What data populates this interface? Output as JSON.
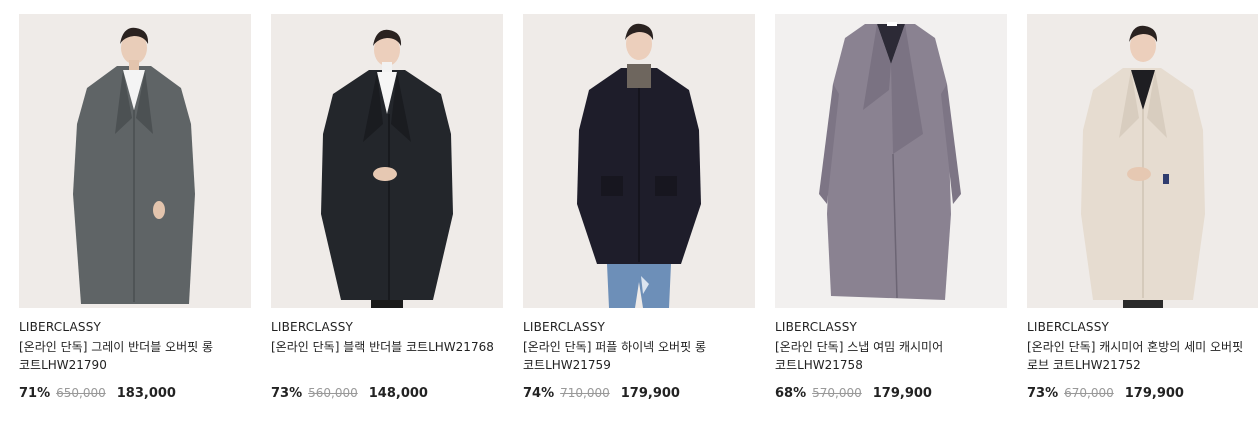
{
  "products": [
    {
      "brand": "LIBERCLASSY",
      "name": "[온라인 단독] 그레이 반더블 오버핏 롱 코트LHW21790",
      "discount": "71%",
      "original_price": "650,000",
      "sale_price": "183,000",
      "image_bg": "#efebe8",
      "coat_color": "#5f6466"
    },
    {
      "brand": "LIBERCLASSY",
      "name": "[온라인 단독] 블랙 반더블 코트LHW21768",
      "discount": "73%",
      "original_price": "560,000",
      "sale_price": "148,000",
      "image_bg": "#efebe8",
      "coat_color": "#23262b"
    },
    {
      "brand": "LIBERCLASSY",
      "name": "[온라인 단독] 퍼플 하이넥 오버핏 롱 코트LHW21759",
      "discount": "74%",
      "original_price": "710,000",
      "sale_price": "179,900",
      "image_bg": "#efebe8",
      "coat_color": "#1e1d2a"
    },
    {
      "brand": "LIBERCLASSY",
      "name": "[온라인 단독] 스냅 여밈 캐시미어 코트LHW21758",
      "discount": "68%",
      "original_price": "570,000",
      "sale_price": "179,900",
      "image_bg": "#f2f0ef",
      "coat_color": "#8a8291"
    },
    {
      "brand": "LIBERCLASSY",
      "name": "[온라인 단독] 캐시미어 혼방의 세미 오버핏 로브 코트LHW21752",
      "discount": "73%",
      "original_price": "670,000",
      "sale_price": "179,900",
      "image_bg": "#efebe8",
      "coat_color": "#e6dcd0"
    }
  ]
}
